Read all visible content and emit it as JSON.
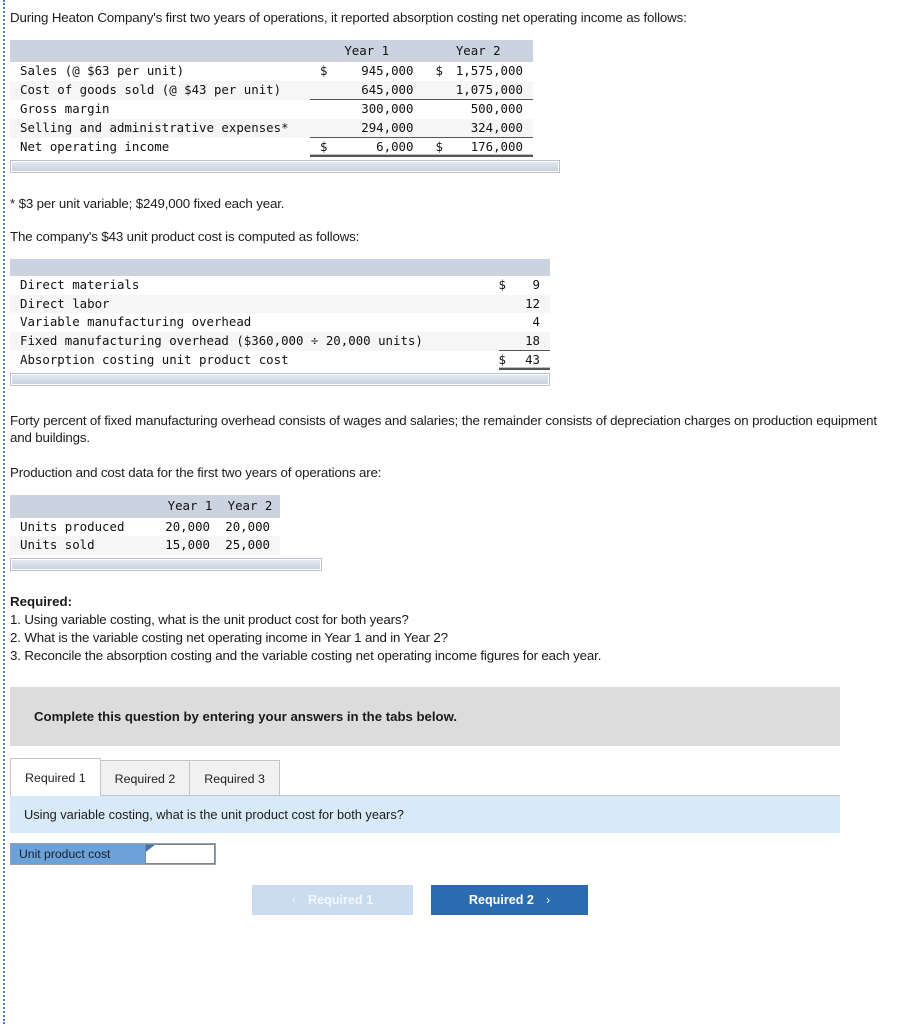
{
  "intro": {
    "paragraph": "During Heaton Company's first two years of operations, it reported absorption costing net operating income as follows:"
  },
  "income_table": {
    "headers": [
      "",
      "Year 1",
      "Year 2"
    ],
    "rows": [
      {
        "label": "Sales (@ $63 per unit)",
        "y1_sym": "$",
        "y1": "945,000",
        "y2_sym": "$",
        "y2": "1,575,000",
        "rule": "none"
      },
      {
        "label": "Cost of goods sold (@ $43 per unit)",
        "y1_sym": "",
        "y1": "645,000",
        "y2_sym": "",
        "y2": "1,075,000",
        "rule": "single"
      },
      {
        "label": "Gross margin",
        "y1_sym": "",
        "y1": "300,000",
        "y2_sym": "",
        "y2": "500,000",
        "rule": "none"
      },
      {
        "label": "Selling and administrative expenses*",
        "y1_sym": "",
        "y1": "294,000",
        "y2_sym": "",
        "y2": "324,000",
        "rule": "single"
      },
      {
        "label": "Net operating income",
        "y1_sym": "$",
        "y1": "6,000",
        "y2_sym": "$",
        "y2": "176,000",
        "rule": "double"
      }
    ]
  },
  "footnote": "* $3 per unit variable; $249,000 fixed each year.",
  "unit_cost_intro": "The company's $43 unit product cost is computed as follows:",
  "unit_cost_table": {
    "headers": [
      "",
      ""
    ],
    "rows": [
      {
        "label": "Direct materials",
        "sym": "$",
        "value": "9",
        "rule": "none"
      },
      {
        "label": "Direct labor",
        "sym": "",
        "value": "12",
        "rule": "none"
      },
      {
        "label": "Variable manufacturing overhead",
        "sym": "",
        "value": "4",
        "rule": "none"
      },
      {
        "label": "Fixed manufacturing overhead ($360,000 ÷ 20,000 units)",
        "sym": "",
        "value": "18",
        "rule": "single"
      },
      {
        "label": "Absorption costing unit product cost",
        "sym": "$",
        "value": "43",
        "rule": "double"
      }
    ]
  },
  "overhead_note": "Forty percent of fixed manufacturing overhead consists of wages and salaries; the remainder consists of depreciation charges on production equipment and buildings.",
  "production_intro": "Production and cost data for the first two years of operations are:",
  "production_table": {
    "headers": [
      "",
      "Year 1",
      "Year 2"
    ],
    "rows": [
      {
        "label": "Units produced",
        "y1": "20,000",
        "y2": "20,000"
      },
      {
        "label": "Units sold",
        "y1": "15,000",
        "y2": "25,000"
      }
    ]
  },
  "required": {
    "title": "Required:",
    "items": [
      "1. Using variable costing, what is the unit product cost for both years?",
      "2. What is the variable costing net operating income in Year 1 and in Year 2?",
      "3. Reconcile the absorption costing and the variable costing net operating income figures for each year."
    ]
  },
  "complete_banner": "Complete this question by entering your answers in the tabs below.",
  "tabs": [
    {
      "label": "Required 1",
      "active": true
    },
    {
      "label": "Required 2",
      "active": false
    },
    {
      "label": "Required 3",
      "active": false
    }
  ],
  "question_bar": "Using variable costing, what is the unit product cost for both years?",
  "answer": {
    "row_label": "Unit product cost",
    "value": "",
    "placeholder": ""
  },
  "nav": {
    "prev_label": "Required 1",
    "prev_chevron": "‹",
    "next_label": "Required 2",
    "next_chevron": "›"
  },
  "colors": {
    "table_header": "#ccd3e0",
    "banner_gray": "#dcdcdc",
    "question_blue": "#d8e9f7",
    "accent_blue": "#2b6cb0",
    "disabled_blue": "#c9dcf0",
    "label_blue": "#6ca2da",
    "rail_blue": "#4a7ebb"
  }
}
